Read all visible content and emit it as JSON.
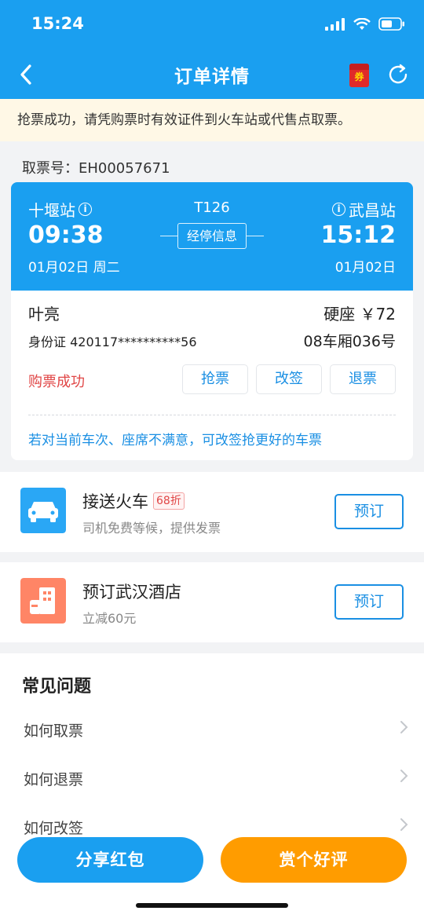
{
  "status_bar": {
    "time": "15:24",
    "signal_icon": "signal-icon",
    "wifi_icon": "wifi-icon",
    "battery_icon": "battery-icon"
  },
  "nav": {
    "title": "订单详情",
    "back_icon": "back-arrow-icon",
    "coupon_label": "券",
    "refresh_icon": "refresh-icon"
  },
  "notice": "抢票成功，请凭购票时有效证件到火车站或代售点取票。",
  "ticket_no": "取票号：EH00057671",
  "trip": {
    "from_station": "十堰站",
    "to_station": "武昌站",
    "train_no": "T126",
    "depart_time": "09:38",
    "arrive_time": "15:12",
    "stop_info_label": "经停信息",
    "depart_date": "01月02日 周二",
    "arrive_date": "01月02日",
    "info_icon": "i"
  },
  "passenger": {
    "name": "叶亮",
    "seat_price": "硬座 ￥72",
    "id_card": "身份证 420117**********56",
    "seat_no": "08车厢036号",
    "status": "购票成功",
    "actions": [
      "抢票",
      "改签",
      "退票"
    ],
    "tip": "若对当前车次、座席不满意，可改签抢更好的车票"
  },
  "services": [
    {
      "title": "接送火车",
      "badge": "68折",
      "subtitle": "司机免费等候，提供发票",
      "button": "预订",
      "icon": "car-icon"
    },
    {
      "title": "预订武汉酒店",
      "badge": "",
      "subtitle": "立减60元",
      "button": "预订",
      "icon": "hotel-icon"
    }
  ],
  "faq": {
    "title": "常见问题",
    "items": [
      "如何取票",
      "如何退票",
      "如何改签"
    ]
  },
  "bottom": {
    "share_label": "分享红包",
    "review_label": "赏个好评"
  },
  "colors": {
    "primary": "#1a9ff0",
    "accent_orange": "#ff9c00",
    "error_red": "#e04646",
    "notice_bg": "#fff8e6"
  }
}
